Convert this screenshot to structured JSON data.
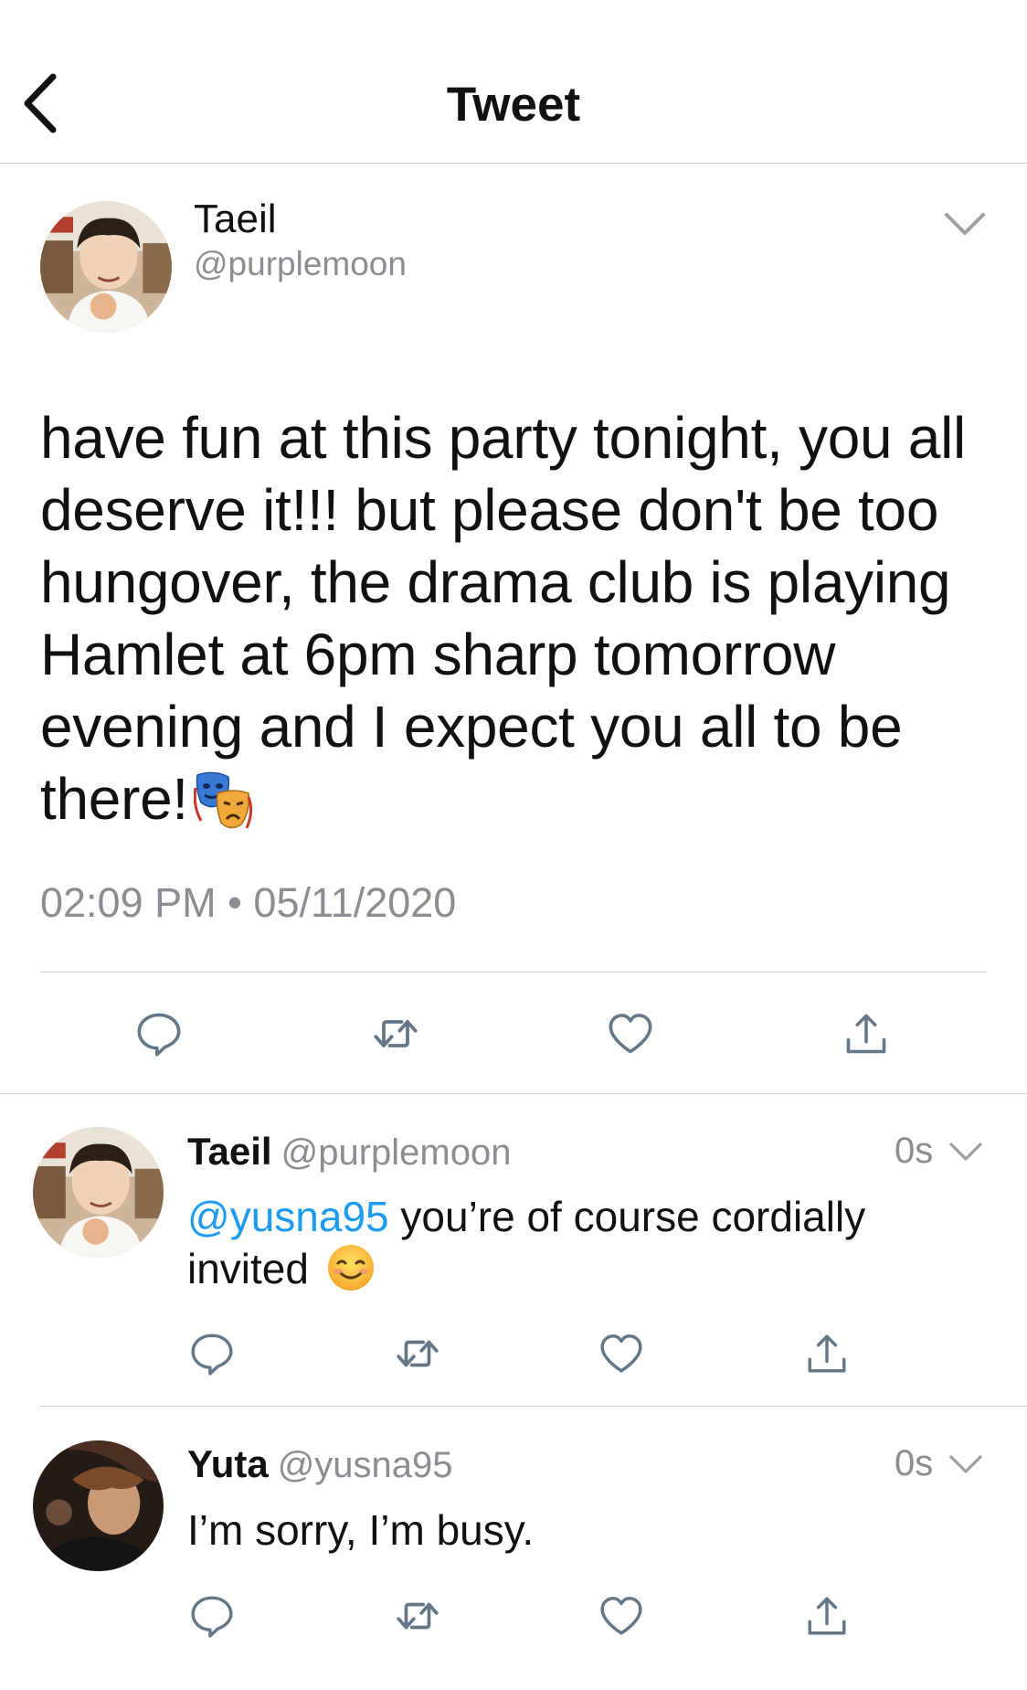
{
  "header": {
    "title": "Tweet"
  },
  "main_tweet": {
    "author_name": "Taeil",
    "author_handle": "@purplemoon",
    "text": "have fun at this party tonight, you all deserve it!!! but please don't be too hungover, the drama club is playing Hamlet at 6pm sharp tomorrow evening and I expect you all to be there!",
    "emoji": "performing-arts-masks",
    "time": "02:09 PM",
    "date": "05/11/2020",
    "separator": "•"
  },
  "replies": [
    {
      "author_name": "Taeil",
      "author_handle": "@purplemoon",
      "time": "0s",
      "mention": "@yusna95",
      "text": " you’re of course cordially invited",
      "emoji": "smiling-face"
    },
    {
      "author_name": "Yuta",
      "author_handle": "@yusna95",
      "time": "0s",
      "text": "I’m sorry, I’m busy."
    }
  ],
  "icons": [
    "back-icon",
    "chevron-down-icon",
    "reply-icon",
    "retweet-icon",
    "like-icon",
    "share-icon"
  ],
  "colors": {
    "text": "#111111",
    "secondary": "#8a8d91",
    "mention": "#1d9bf0",
    "divider": "#d4d4d8",
    "icon": "#657786"
  }
}
